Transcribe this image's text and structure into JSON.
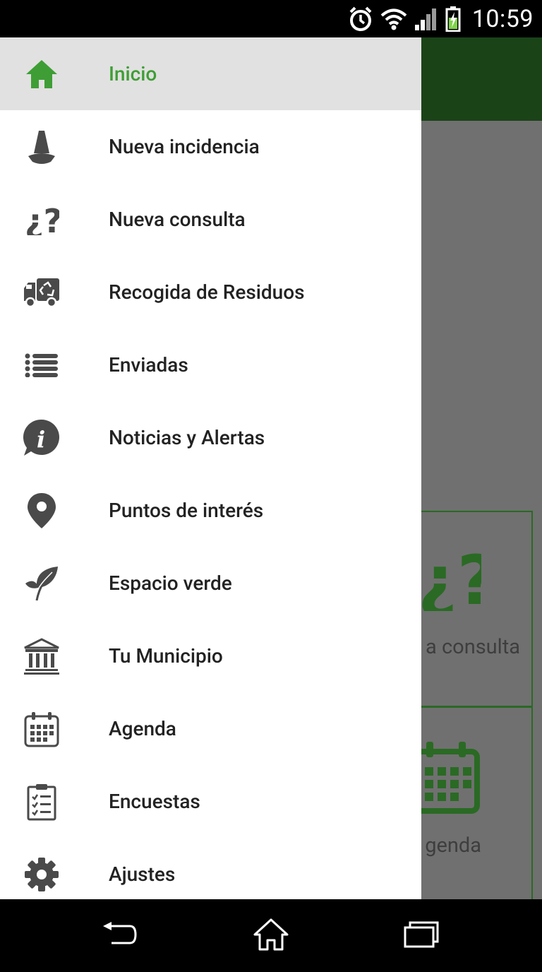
{
  "status_bar": {
    "time": "10:59",
    "icons": [
      "alarm-icon",
      "wifi-icon",
      "signal-icon",
      "battery-charging-icon"
    ]
  },
  "background_app": {
    "toolbar_color": "#1b4318",
    "cards": [
      {
        "label": "a consulta",
        "icon": "question-icon"
      },
      {
        "label": "genda",
        "icon": "calendar-icon"
      }
    ]
  },
  "drawer": {
    "accent_color": "#3e9e35",
    "items": [
      {
        "label": "Inicio",
        "icon": "home-icon",
        "active": true
      },
      {
        "label": "Nueva incidencia",
        "icon": "cone-icon"
      },
      {
        "label": "Nueva consulta",
        "icon": "question-icon"
      },
      {
        "label": "Recogida de Residuos",
        "icon": "recycling-truck-icon"
      },
      {
        "label": "Enviadas",
        "icon": "list-icon"
      },
      {
        "label": "Noticias y Alertas",
        "icon": "info-icon"
      },
      {
        "label": "Puntos de interés",
        "icon": "map-pin-icon"
      },
      {
        "label": "Espacio verde",
        "icon": "leaf-icon"
      },
      {
        "label": "Tu Municipio",
        "icon": "municipality-icon"
      },
      {
        "label": "Agenda",
        "icon": "calendar-icon"
      },
      {
        "label": "Encuestas",
        "icon": "survey-icon"
      },
      {
        "label": "Ajustes",
        "icon": "gear-icon"
      }
    ]
  },
  "nav_bar": {
    "buttons": [
      "back-icon",
      "home-icon",
      "recents-icon"
    ]
  }
}
